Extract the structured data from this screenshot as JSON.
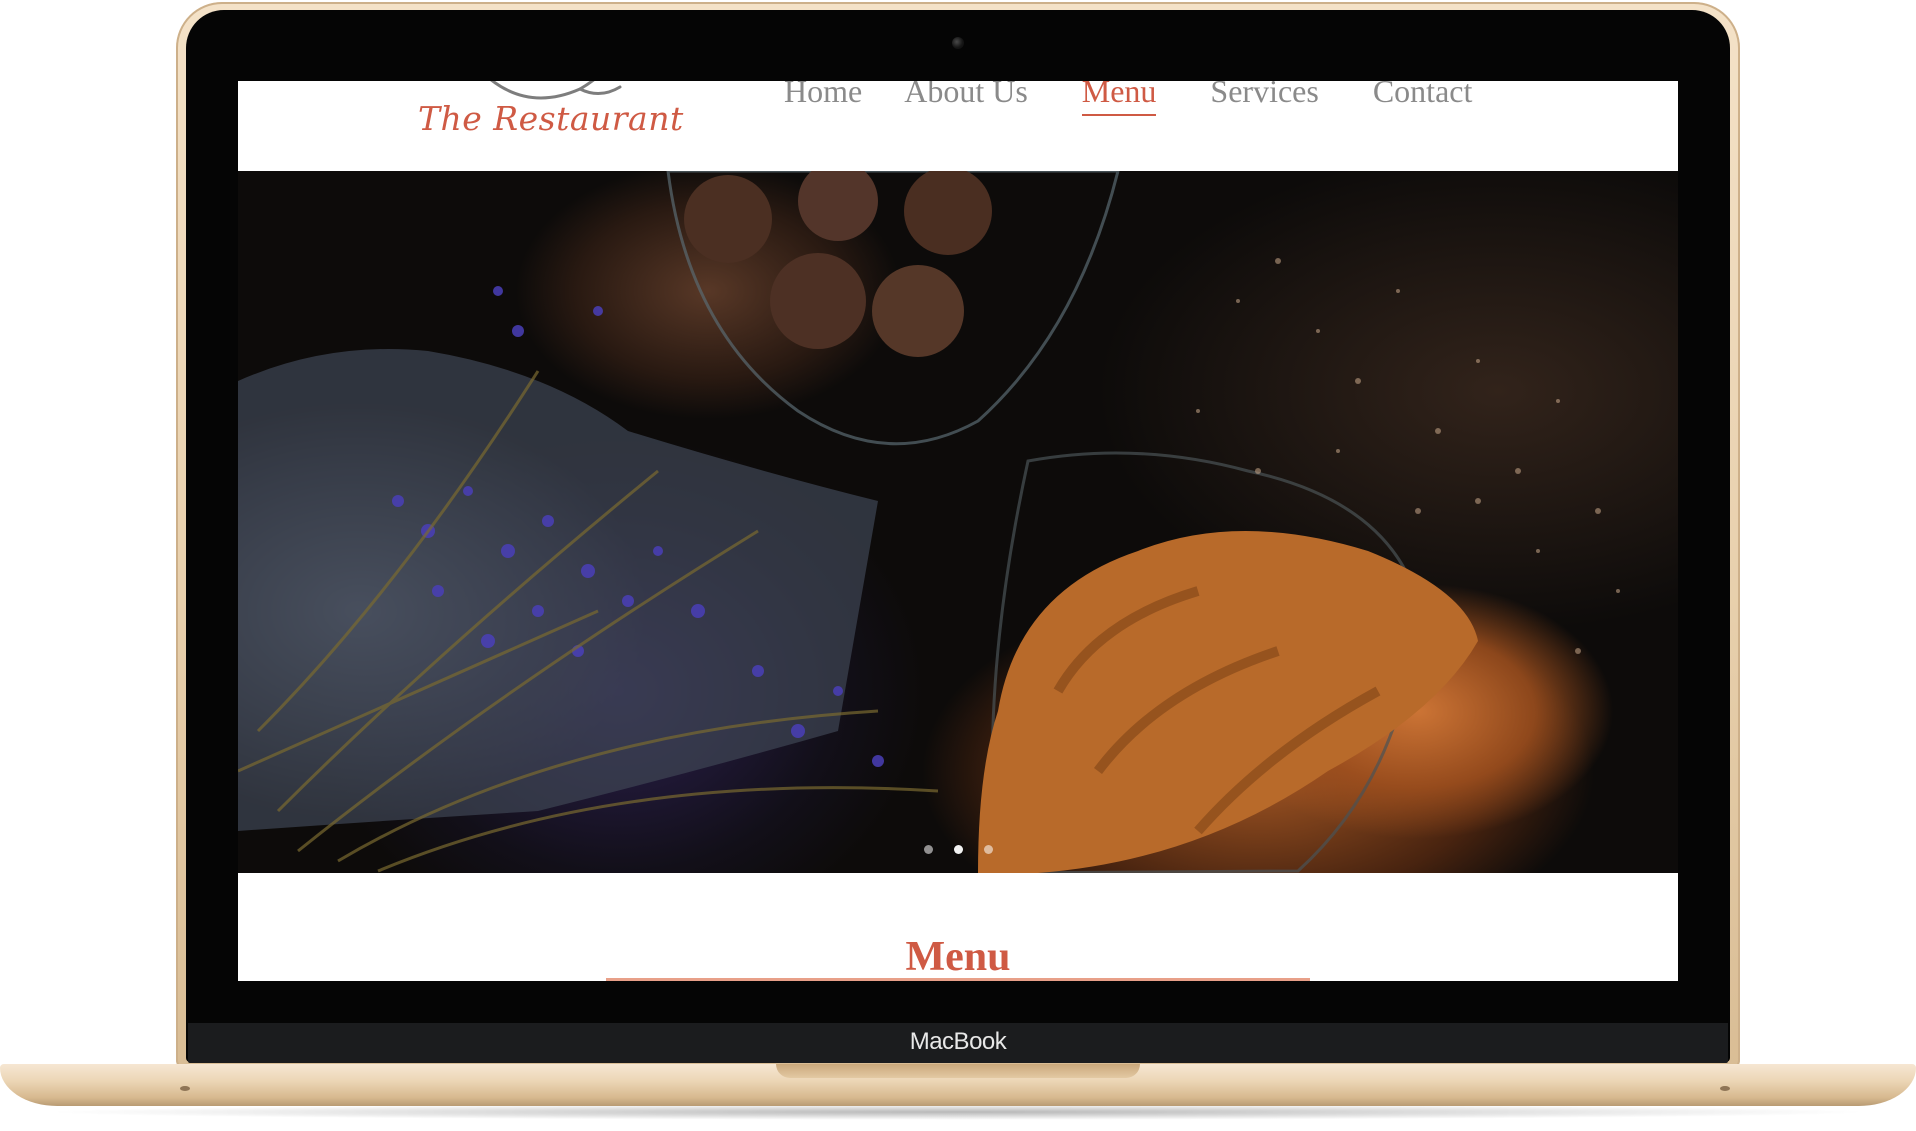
{
  "device": {
    "brand_label": "MacBook"
  },
  "site": {
    "logo_text": "The Restaurant",
    "nav": [
      {
        "label": "Home",
        "active": false
      },
      {
        "label": "About Us",
        "active": false
      },
      {
        "label": "Menu",
        "active": true
      },
      {
        "label": "Services",
        "active": false
      },
      {
        "label": "Contact",
        "active": false
      }
    ]
  },
  "hero": {
    "slide_count": 3,
    "active_slide": 1
  },
  "section": {
    "title": "Menu"
  },
  "colors": {
    "accent": "#cf5a44",
    "nav_text": "#8a8a8a",
    "section_rule": "#e8a089"
  },
  "icons": [
    "fish-logo-icon"
  ]
}
